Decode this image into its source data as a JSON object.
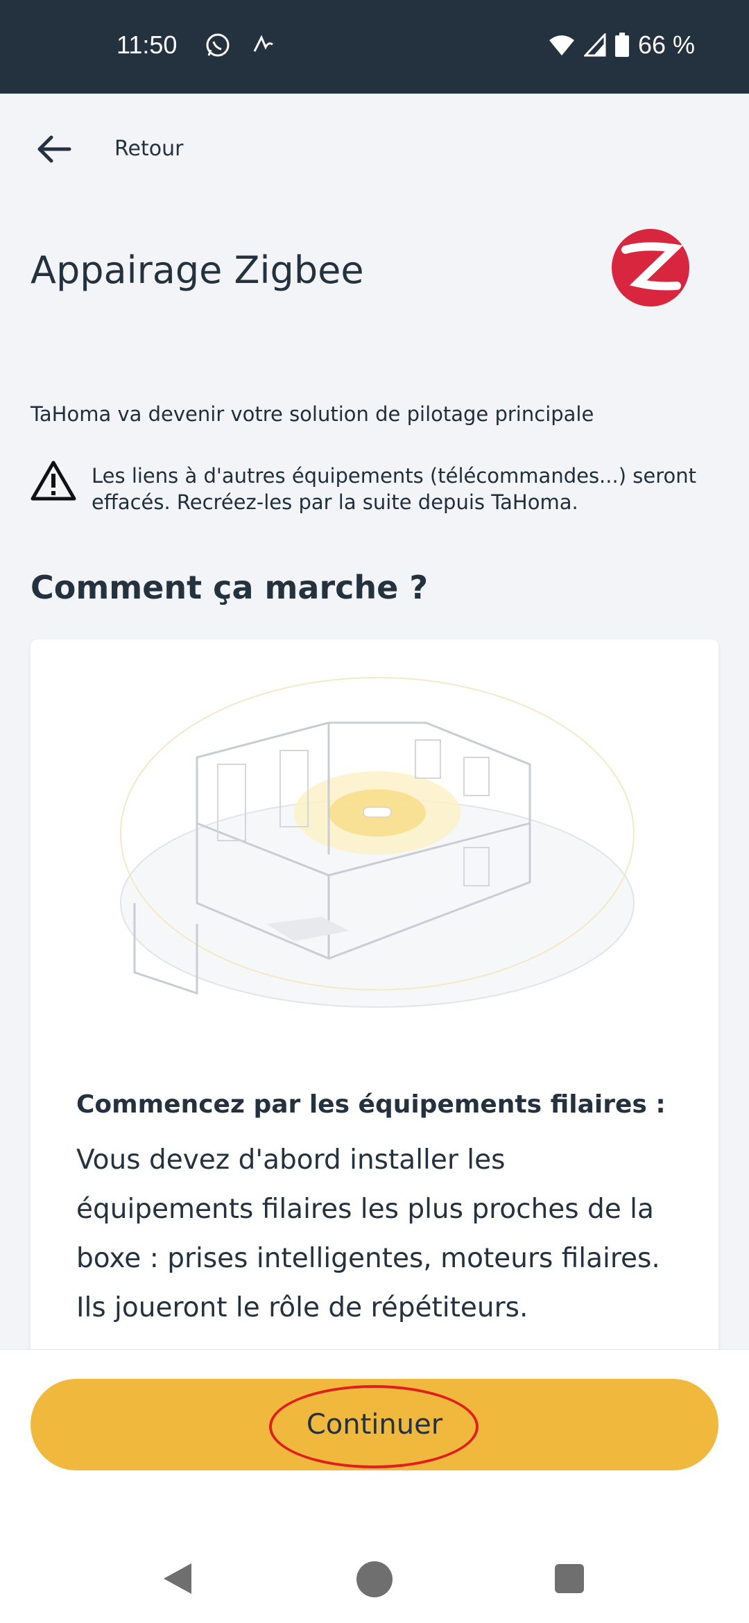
{
  "status_bar": {
    "time": "11:50",
    "battery": "66 %",
    "left_icons": [
      "whatsapp-icon",
      "signature-icon"
    ],
    "right_icons": [
      "wifi-icon",
      "signal-icon",
      "battery-icon"
    ]
  },
  "header": {
    "back_label": "Retour"
  },
  "page": {
    "title": "Appairage Zigbee",
    "intro": "TaHoma va devenir votre solution de pilotage principale",
    "warning": "Les liens à d'autres équipements (télécommandes...) seront effacés. Recréez-les par la suite depuis TaHoma.",
    "section_title": "Comment ça marche ?"
  },
  "card": {
    "heading": "Commencez par les équipements filaires :",
    "body": "Vous devez d'abord installer les équipements filaires les plus proches de la boxe : prises intelligentes, moteurs filaires. Ils joueront le rôle de répétiteurs."
  },
  "footer": {
    "continue_label": "Continuer"
  },
  "colors": {
    "status_bar": "#24313f",
    "accent": "#f0b93e",
    "zigbee_red": "#d7263d",
    "highlight": "#e02020"
  }
}
